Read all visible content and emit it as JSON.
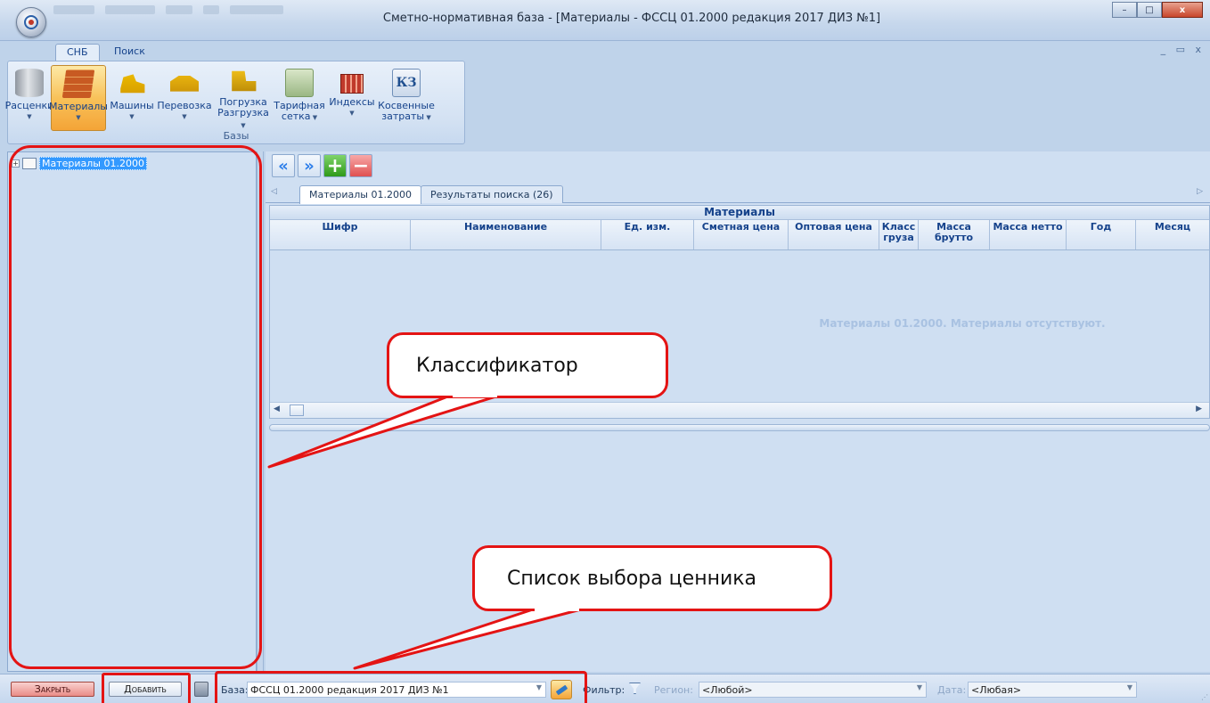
{
  "window": {
    "title": "Сметно-нормативная база - [Материалы - ФССЦ 01.2000 редакция 2017 ДИЗ №1]",
    "min": "–",
    "max": "□",
    "close": "x"
  },
  "ribbon_tabs": [
    "СНБ",
    "Поиск"
  ],
  "mdi_controls": "_ ▭ x",
  "ribbon": {
    "group_label": "Базы",
    "buttons": [
      {
        "label": "Расценки",
        "label2": "",
        "icon": "database-icon"
      },
      {
        "label": "Материалы",
        "label2": "",
        "icon": "bricks-icon"
      },
      {
        "label": "Машины",
        "label2": "",
        "icon": "bulldozer-icon"
      },
      {
        "label": "Перевозка",
        "label2": "",
        "icon": "dump-truck-icon"
      },
      {
        "label": "Погрузка",
        "label2": "Разгрузка",
        "icon": "forklift-icon"
      },
      {
        "label": "Тарифная",
        "label2": "сетка",
        "icon": "money-stack-icon"
      },
      {
        "label": "Индексы",
        "label2": "",
        "icon": "index-icon"
      },
      {
        "label": "Косвенные",
        "label2": "затраты",
        "icon": "kz-icon"
      }
    ],
    "kz_text": "КЗ"
  },
  "tree": {
    "root_label": "Материалы 01.2000"
  },
  "doc_tabs": [
    "Материалы 01.2000",
    "Результаты поиска (26)"
  ],
  "grid": {
    "band": "Материалы",
    "columns": [
      "Шифр",
      "Наименование",
      "Ед. изм.",
      "Сметная цена",
      "Оптовая цена",
      "Класс\nгруза",
      "Масса\nбрутто",
      "Масса нетто",
      "Год",
      "Месяц"
    ],
    "empty_text": "Материалы 01.2000. Материалы отсутствуют."
  },
  "statusbar": {
    "close_label": "Закрыть",
    "add_label": "Добавить",
    "base_label": "База:",
    "base_value": "ФССЦ 01.2000 редакция 2017 ДИЗ №1",
    "filter_label": "Фильтр:",
    "region_label": "Регион:",
    "region_value": "<Любой>",
    "date_label": "Дата:",
    "date_value": "<Любая>"
  },
  "annotations": {
    "classifier": "Классификатор",
    "price_list": "Список выбора ценника"
  },
  "colors": {
    "annotation_red": "#e41414",
    "ribbon_active": "#f8c25a"
  }
}
